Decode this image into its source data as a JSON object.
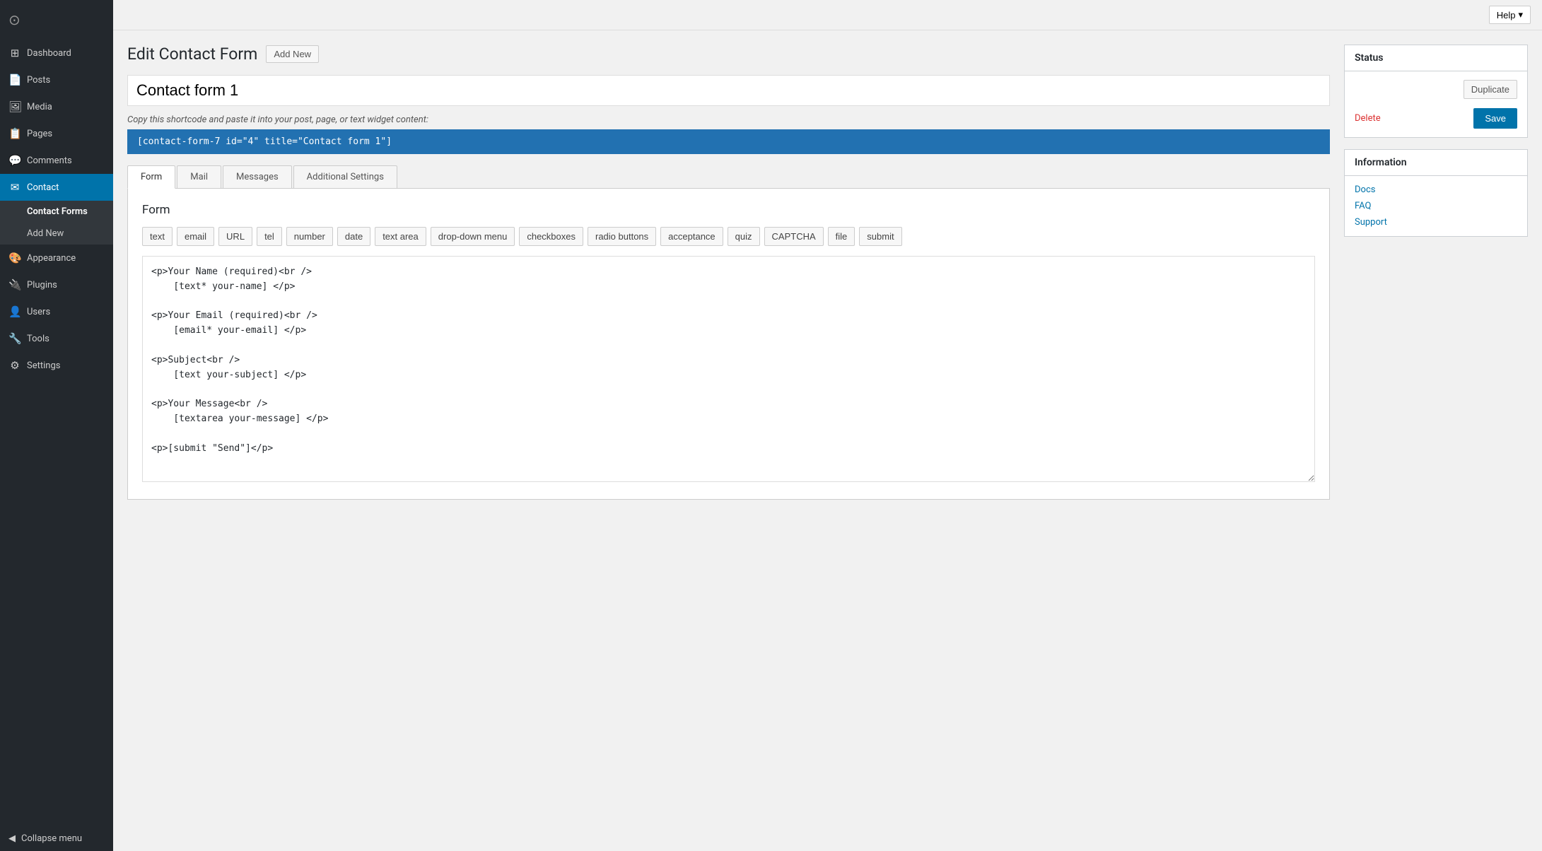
{
  "sidebar": {
    "items": [
      {
        "id": "dashboard",
        "label": "Dashboard",
        "icon": "⊞"
      },
      {
        "id": "posts",
        "label": "Posts",
        "icon": "📄"
      },
      {
        "id": "media",
        "label": "Media",
        "icon": "🖼"
      },
      {
        "id": "pages",
        "label": "Pages",
        "icon": "📋"
      },
      {
        "id": "comments",
        "label": "Comments",
        "icon": "💬"
      },
      {
        "id": "contact",
        "label": "Contact",
        "icon": "✉",
        "active": true
      },
      {
        "id": "appearance",
        "label": "Appearance",
        "icon": "🎨"
      },
      {
        "id": "plugins",
        "label": "Plugins",
        "icon": "🔌"
      },
      {
        "id": "users",
        "label": "Users",
        "icon": "👤"
      },
      {
        "id": "tools",
        "label": "Tools",
        "icon": "🔧"
      },
      {
        "id": "settings",
        "label": "Settings",
        "icon": "⚙"
      }
    ],
    "submenu": [
      {
        "id": "contact-forms",
        "label": "Contact Forms",
        "active": true
      },
      {
        "id": "add-new",
        "label": "Add New"
      }
    ],
    "collapse_label": "Collapse menu"
  },
  "topbar": {
    "help_label": "Help"
  },
  "page": {
    "title": "Edit Contact Form",
    "add_new_label": "Add New",
    "form_title": "Contact form 1",
    "shortcode_label": "Copy this shortcode and paste it into your post, page, or text widget content:",
    "shortcode_value": "[contact-form-7 id=\"4\" title=\"Contact form 1\"]"
  },
  "tabs": [
    {
      "id": "form",
      "label": "Form",
      "active": true
    },
    {
      "id": "mail",
      "label": "Mail"
    },
    {
      "id": "messages",
      "label": "Messages"
    },
    {
      "id": "additional-settings",
      "label": "Additional Settings"
    }
  ],
  "form_editor": {
    "section_title": "Form",
    "tag_buttons": [
      "text",
      "email",
      "URL",
      "tel",
      "number",
      "date",
      "text area",
      "drop-down menu",
      "checkboxes",
      "radio buttons",
      "acceptance",
      "quiz",
      "CAPTCHA",
      "file",
      "submit"
    ],
    "code_content": "<p>Your Name (required)<br />\n    [text* your-name] </p>\n\n<p>Your Email (required)<br />\n    [email* your-email] </p>\n\n<p>Subject<br />\n    [text your-subject] </p>\n\n<p>Your Message<br />\n    [textarea your-message] </p>\n\n<p>[submit \"Send\"]</p>"
  },
  "status_box": {
    "title": "Status",
    "duplicate_label": "Duplicate",
    "delete_label": "Delete",
    "save_label": "Save"
  },
  "information_box": {
    "title": "Information",
    "links": [
      {
        "id": "docs",
        "label": "Docs"
      },
      {
        "id": "faq",
        "label": "FAQ"
      },
      {
        "id": "support",
        "label": "Support"
      }
    ]
  }
}
